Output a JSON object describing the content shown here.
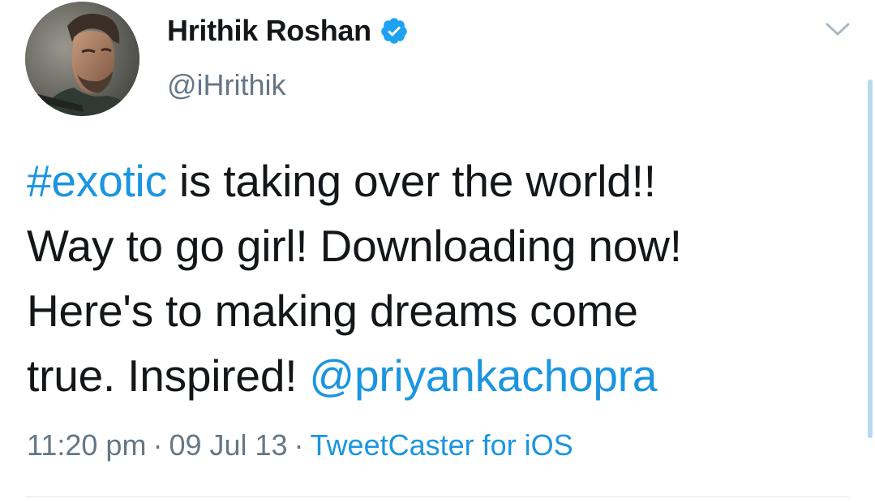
{
  "author": {
    "display_name": "Hrithik Roshan",
    "handle": "@iHrithik",
    "verified": true,
    "avatar_icon": "profile-photo"
  },
  "tweet": {
    "hashtag": "#exotic",
    "line1_rest": " is taking over the world!!",
    "line2": "Way to go girl! Downloading now!",
    "line3": "Here's to making dreams come",
    "line4_start": "true. Inspired! ",
    "mention": "@priyankachopra"
  },
  "meta": {
    "time": "11:20 pm",
    "separator": "·",
    "date": "09 Jul 13",
    "source": "TweetCaster for iOS"
  },
  "icons": {
    "verified": "verified-badge-icon",
    "menu": "chevron-down-icon"
  },
  "colors": {
    "link": "#1b95e0",
    "text": "#14171a",
    "secondary": "#657786",
    "verified": "#1da1f2"
  }
}
